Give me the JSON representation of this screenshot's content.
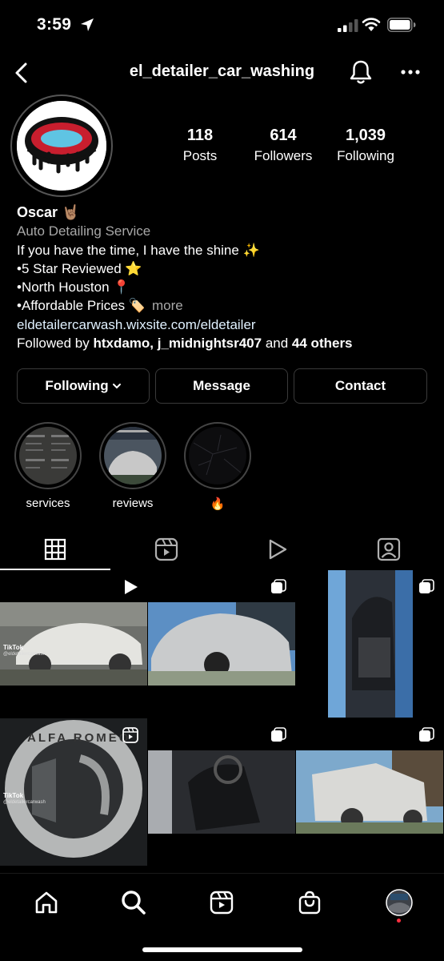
{
  "status_bar": {
    "time": "3:59"
  },
  "header": {
    "username": "el_detailer_car_washing"
  },
  "stats": [
    {
      "value": "118",
      "label": "Posts"
    },
    {
      "value": "614",
      "label": "Followers"
    },
    {
      "value": "1,039",
      "label": "Following"
    }
  ],
  "bio": {
    "name": "Oscar 🤘🏽",
    "category": "Auto Detailing Service",
    "lines": [
      "If you have the time, I have the shine ✨",
      "•5 Star Reviewed ⭐️",
      "•North Houston 📍",
      "•Affordable Prices 🏷️"
    ],
    "more": "more",
    "link": "eldetailercarwash.wixsite.com/eldetailer",
    "followed_by_prefix": "Followed by ",
    "followed_by_users": "htxdamo, j_midnightsr407",
    "followed_by_and": " and ",
    "followed_by_others": "44 others"
  },
  "actions": {
    "following": "Following",
    "message": "Message",
    "contact": "Contact"
  },
  "highlights": [
    {
      "label": "services"
    },
    {
      "label": "reviews"
    },
    {
      "label": "🔥"
    }
  ],
  "grid": {
    "watermark": "TikTok",
    "watermark_handle": "@eldetailercarwash",
    "logo_text": "ALFA ROMEO"
  },
  "colors": {
    "background": "#000000",
    "text": "#ffffff",
    "secondary_text": "#a8a8a8",
    "link": "#e0f1ff",
    "button_border": "#3a3a3a",
    "notification_dot": "#ff3040"
  }
}
